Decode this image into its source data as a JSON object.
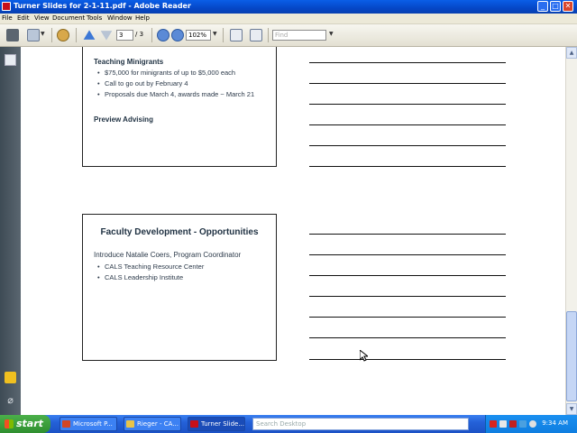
{
  "window": {
    "title": "Turner Slides for 2-1-11.pdf - Adobe Reader"
  },
  "menu": [
    "File",
    "Edit",
    "View",
    "Document",
    "Tools",
    "Window",
    "Help"
  ],
  "toolbar": {
    "current_page": "3",
    "page_total": "/ 3",
    "zoom": "102%",
    "find_placeholder": "Find"
  },
  "slides": {
    "slide1": {
      "heading1": "Teaching Minigrants",
      "bullets": [
        "$75,000 for minigrants of up to $5,000 each",
        "Call to go out by February 4",
        "Proposals due March 4, awards made ~ March 21"
      ],
      "heading2": "Preview Advising"
    },
    "slide2": {
      "title": "Faculty Development - Opportunities",
      "intro": "Introduce Natalie Coers, Program Coordinator",
      "bullets": [
        "CALS Teaching Resource Center",
        "CALS Leadership Institute"
      ]
    }
  },
  "taskbar": {
    "start": "start",
    "tasks": [
      "Microsoft P...",
      "Rieger - CA...",
      "Turner Slide..."
    ],
    "search_placeholder": "Search Desktop",
    "clock": "9:34 AM"
  },
  "icons": {
    "print": "printer-icon",
    "email": "email-icon",
    "tools": "tools-icon",
    "prev": "up-arrow-icon",
    "next": "down-arrow-icon",
    "zoom_out": "zoom-out-icon",
    "zoom_in": "zoom-in-icon",
    "fit_page": "fit-page-icon",
    "fit_width": "fit-width-icon",
    "pages": "pages-icon",
    "comment": "comment-icon",
    "attachment": "paperclip-icon"
  }
}
